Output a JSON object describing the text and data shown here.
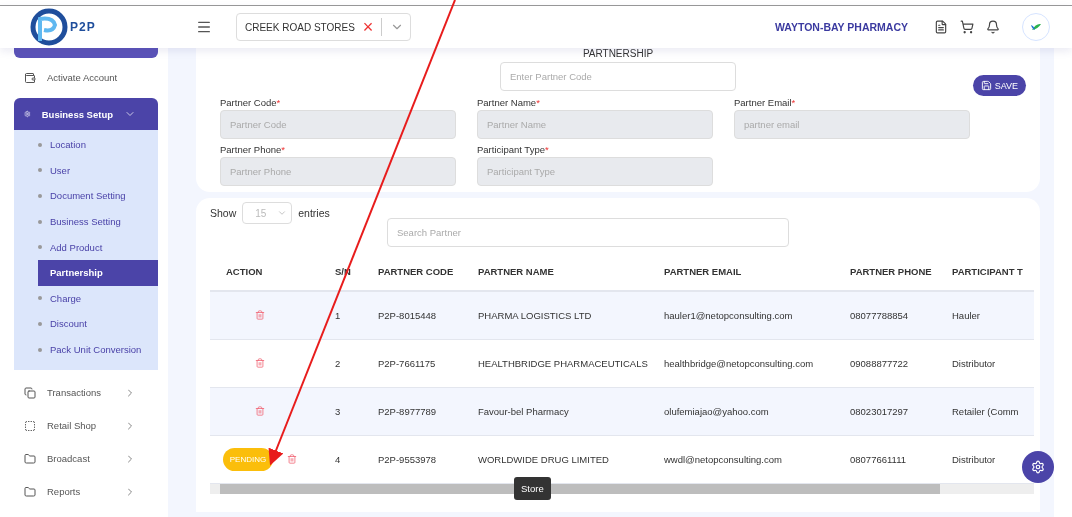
{
  "header": {
    "logo_text": "P2P",
    "store_select": {
      "value": "CREEK ROAD STORES",
      "clear": "×"
    },
    "company": "WAYTON-BAY PHARMACY"
  },
  "sidebar": {
    "items": [
      {
        "label": "Activate Account",
        "kind": "link",
        "selected": false
      },
      {
        "label": "Business Setup",
        "kind": "group",
        "selected": true,
        "expanded": true,
        "children": [
          {
            "label": "Location",
            "selected": false
          },
          {
            "label": "User",
            "selected": false
          },
          {
            "label": "Document Setting",
            "selected": false
          },
          {
            "label": "Business Setting",
            "selected": false
          },
          {
            "label": "Add Product",
            "selected": false
          },
          {
            "label": "Partnership",
            "selected": true
          },
          {
            "label": "Charge",
            "selected": false
          },
          {
            "label": "Discount",
            "selected": false
          },
          {
            "label": "Pack Unit Conversion",
            "selected": false
          }
        ]
      },
      {
        "label": "Transactions",
        "kind": "group",
        "selected": false,
        "expanded": false
      },
      {
        "label": "Retail Shop",
        "kind": "group",
        "selected": false,
        "expanded": false
      },
      {
        "label": "Broadcast",
        "kind": "group",
        "selected": false,
        "expanded": false
      },
      {
        "label": "Reports",
        "kind": "group",
        "selected": false,
        "expanded": false
      }
    ]
  },
  "form": {
    "title": "PARTNERSHIP",
    "lookup": {
      "placeholder": "Enter Partner Code"
    },
    "save": "SAVE",
    "fields": [
      {
        "label": "Partner Code",
        "mark": "*",
        "placeholder": "Partner Code"
      },
      {
        "label": "Partner Name",
        "mark": "*",
        "placeholder": "Partner Name"
      },
      {
        "label": "Partner Email",
        "mark": "*",
        "placeholder": "partner email"
      },
      {
        "label": "Partner Phone",
        "mark": "*",
        "placeholder": "Partner Phone"
      },
      {
        "label": "Participant Type",
        "mark": "*",
        "placeholder": "Participant Type"
      }
    ]
  },
  "table": {
    "show": "Show",
    "page_size": "15",
    "entries": "entries",
    "search": {
      "placeholder": "Search Partner"
    },
    "columns": [
      "ACTION",
      "S/N",
      "PARTNER CODE",
      "PARTNER NAME",
      "PARTNER EMAIL",
      "PARTNER PHONE",
      "PARTICIPANT T"
    ],
    "rows": [
      {
        "cells": [
          "",
          "1",
          "P2P-8015448",
          "PHARMA LOGISTICS LTD",
          "hauler1@netopconsulting.com",
          "08077788854",
          "Hauler"
        ]
      },
      {
        "cells": [
          "",
          "2",
          "P2P-7661175",
          "HEALTHBRIDGE PHARMACEUTICALS",
          "healthbridge@netopconsulting.com",
          "09088877722",
          "Distributor"
        ]
      },
      {
        "cells": [
          "",
          "3",
          "P2P-8977789",
          "Favour-bel Pharmacy",
          "olufemiajao@yahoo.com",
          "08023017297",
          "Retailer (Comm"
        ]
      },
      {
        "cells": [
          "PENDING",
          "4",
          "P2P-9553978",
          "WORLDWIDE DRUG LIMITED",
          "wwdl@netopconsulting.com",
          "08077661111",
          "Distributor"
        ]
      }
    ]
  },
  "tooltip": "Store"
}
